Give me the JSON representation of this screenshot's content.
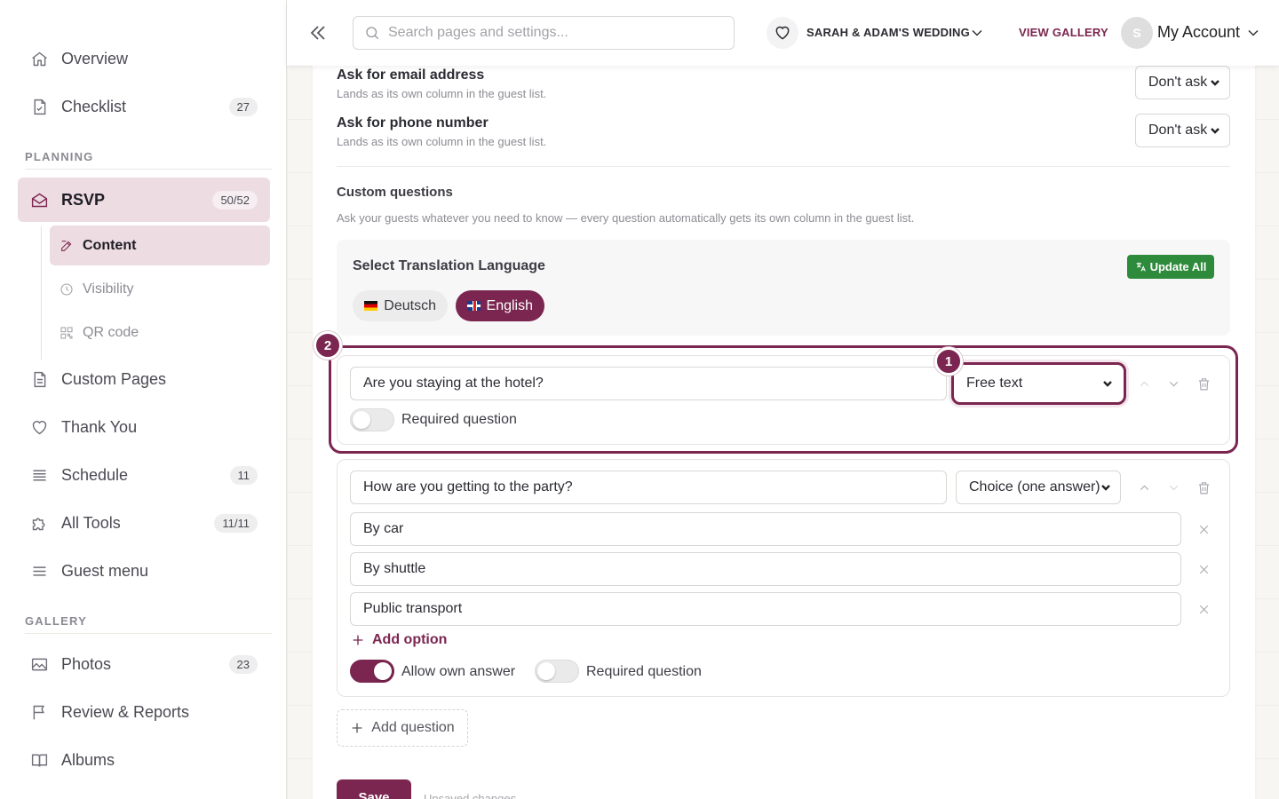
{
  "sidebar": {
    "items": [
      {
        "label": "Overview",
        "icon": "home-icon"
      },
      {
        "label": "Checklist",
        "icon": "checklist-icon",
        "badge": "27"
      },
      {
        "label": "RSVP",
        "icon": "envelope-icon",
        "badge": "50/52"
      },
      {
        "label": "Custom Pages",
        "icon": "page-icon"
      },
      {
        "label": "Thank You",
        "icon": "heart-icon"
      },
      {
        "label": "Schedule",
        "icon": "list-icon",
        "badge": "11"
      },
      {
        "label": "All Tools",
        "icon": "puzzle-icon",
        "badge": "11/11"
      },
      {
        "label": "Guest menu",
        "icon": "menu-icon"
      },
      {
        "label": "Photos",
        "icon": "image-icon",
        "badge": "23"
      },
      {
        "label": "Review & Reports",
        "icon": "flag-icon"
      },
      {
        "label": "Albums",
        "icon": "book-icon"
      }
    ],
    "sections": {
      "planning": "PLANNING",
      "gallery": "GALLERY"
    },
    "rsvp_sub": [
      {
        "label": "Content",
        "icon": "edit-icon"
      },
      {
        "label": "Visibility",
        "icon": "clock-icon"
      },
      {
        "label": "QR code",
        "icon": "qr-icon"
      }
    ]
  },
  "topbar": {
    "search_placeholder": "Search pages and settings...",
    "wedding_name": "SARAH & ADAM'S WEDDING",
    "view_gallery": "VIEW GALLERY",
    "avatar_initial": "S",
    "account_label": "My Account"
  },
  "settings": {
    "email": {
      "label": "Ask for email address",
      "help": "Lands as its own column in the guest list.",
      "value": "Don't ask"
    },
    "phone": {
      "label": "Ask for phone number",
      "help": "Lands as its own column in the guest list.",
      "value": "Don't ask"
    }
  },
  "custom_questions": {
    "title": "Custom questions",
    "help": "Ask your guests whatever you need to know — every question automatically gets its own column in the guest list.",
    "translation": {
      "title": "Select Translation Language",
      "update_all": "Update All",
      "languages": [
        {
          "label": "Deutsch",
          "selected": false
        },
        {
          "label": "English",
          "selected": true
        }
      ]
    },
    "questions": [
      {
        "text": "Are you staying at the hotel?",
        "type": "Free text",
        "required_label": "Required question",
        "required": false
      },
      {
        "text": "How are you getting to the party?",
        "type": "Choice (one answer)",
        "options": [
          "By car",
          "By shuttle",
          "Public transport"
        ],
        "add_option": "Add option",
        "allow_own_label": "Allow own answer",
        "allow_own": true,
        "required_label": "Required question",
        "required": false
      }
    ],
    "add_question": "Add question"
  },
  "footer": {
    "save": "Save",
    "unsaved": "Unsaved changes"
  },
  "annotations": {
    "step1": "1",
    "step2": "2"
  },
  "colors": {
    "accent": "#7b2650",
    "accent_soft": "#eddce2",
    "update_green": "#2f8b3c"
  }
}
